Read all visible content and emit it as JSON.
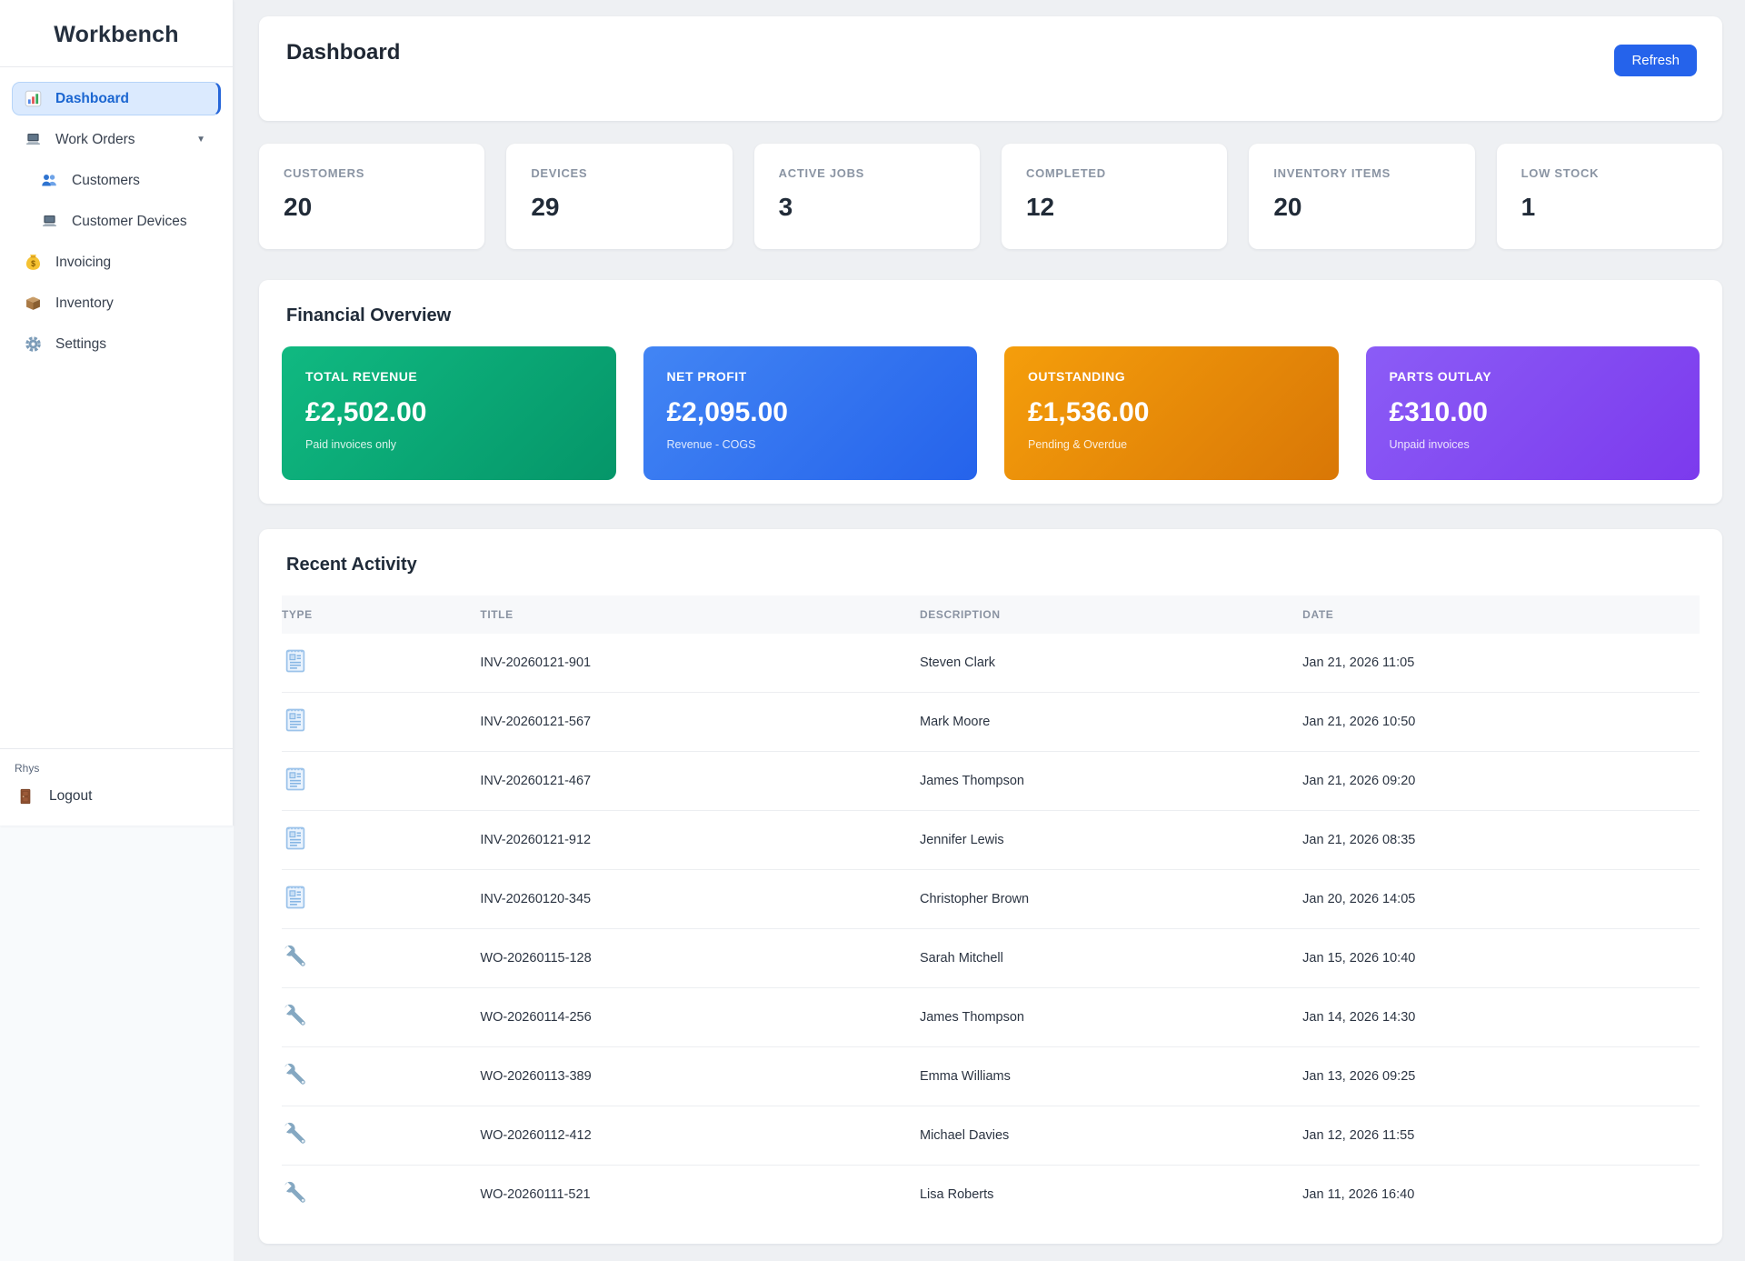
{
  "sidebar": {
    "brand": "Workbench",
    "items": [
      {
        "label": "Dashboard",
        "icon": "bar-chart-icon",
        "active": true
      },
      {
        "label": "Work Orders",
        "icon": "laptop-icon",
        "chevron": "▼"
      },
      {
        "label": "Customers",
        "icon": "people-icon",
        "indented": true
      },
      {
        "label": "Customer Devices",
        "icon": "laptop-icon",
        "indented": true
      },
      {
        "label": "Invoicing",
        "icon": "money-bag-icon"
      },
      {
        "label": "Inventory",
        "icon": "package-icon"
      },
      {
        "label": "Settings",
        "icon": "gear-icon"
      }
    ],
    "user": {
      "name": "Rhys",
      "logout_label": "Logout",
      "logout_icon": "door-icon"
    }
  },
  "header": {
    "title": "Dashboard",
    "refresh_label": "Refresh"
  },
  "stats": [
    {
      "label": "CUSTOMERS",
      "value": "20"
    },
    {
      "label": "DEVICES",
      "value": "29"
    },
    {
      "label": "ACTIVE JOBS",
      "value": "3"
    },
    {
      "label": "COMPLETED",
      "value": "12"
    },
    {
      "label": "INVENTORY ITEMS",
      "value": "20"
    },
    {
      "label": "LOW STOCK",
      "value": "1"
    }
  ],
  "financial": {
    "title": "Financial Overview",
    "cards": [
      {
        "label": "TOTAL REVENUE",
        "value": "£2,502.00",
        "note": "Paid invoices only",
        "color_from": "#10b981",
        "color_to": "#059669"
      },
      {
        "label": "NET PROFIT",
        "value": "£2,095.00",
        "note": "Revenue - COGS",
        "color_from": "#4285f4",
        "color_to": "#2563eb"
      },
      {
        "label": "OUTSTANDING",
        "value": "£1,536.00",
        "note": "Pending & Overdue",
        "color_from": "#f59e0b",
        "color_to": "#d97706"
      },
      {
        "label": "PARTS OUTLAY",
        "value": "£310.00",
        "note": "Unpaid invoices",
        "color_from": "#8b5cf6",
        "color_to": "#7c3aed"
      }
    ]
  },
  "activity": {
    "title": "Recent Activity",
    "columns": [
      "Type",
      "Title",
      "Description",
      "Date"
    ],
    "rows": [
      {
        "type": "invoice",
        "icon": "receipt-icon",
        "title": "INV-20260121-901",
        "description": "Steven Clark",
        "date": "Jan 21, 2026 11:05"
      },
      {
        "type": "invoice",
        "icon": "receipt-icon",
        "title": "INV-20260121-567",
        "description": "Mark Moore",
        "date": "Jan 21, 2026 10:50"
      },
      {
        "type": "invoice",
        "icon": "receipt-icon",
        "title": "INV-20260121-467",
        "description": "James Thompson",
        "date": "Jan 21, 2026 09:20"
      },
      {
        "type": "invoice",
        "icon": "receipt-icon",
        "title": "INV-20260121-912",
        "description": "Jennifer Lewis",
        "date": "Jan 21, 2026 08:35"
      },
      {
        "type": "invoice",
        "icon": "receipt-icon",
        "title": "INV-20260120-345",
        "description": "Christopher Brown",
        "date": "Jan 20, 2026 14:05"
      },
      {
        "type": "work_order",
        "icon": "wrench-icon",
        "title": "WO-20260115-128",
        "description": "Sarah Mitchell",
        "date": "Jan 15, 2026 10:40"
      },
      {
        "type": "work_order",
        "icon": "wrench-icon",
        "title": "WO-20260114-256",
        "description": "James Thompson",
        "date": "Jan 14, 2026 14:30"
      },
      {
        "type": "work_order",
        "icon": "wrench-icon",
        "title": "WO-20260113-389",
        "description": "Emma Williams",
        "date": "Jan 13, 2026 09:25"
      },
      {
        "type": "work_order",
        "icon": "wrench-icon",
        "title": "WO-20260112-412",
        "description": "Michael Davies",
        "date": "Jan 12, 2026 11:55"
      },
      {
        "type": "work_order",
        "icon": "wrench-icon",
        "title": "WO-20260111-521",
        "description": "Lisa Roberts",
        "date": "Jan 11, 2026 16:40"
      }
    ]
  }
}
